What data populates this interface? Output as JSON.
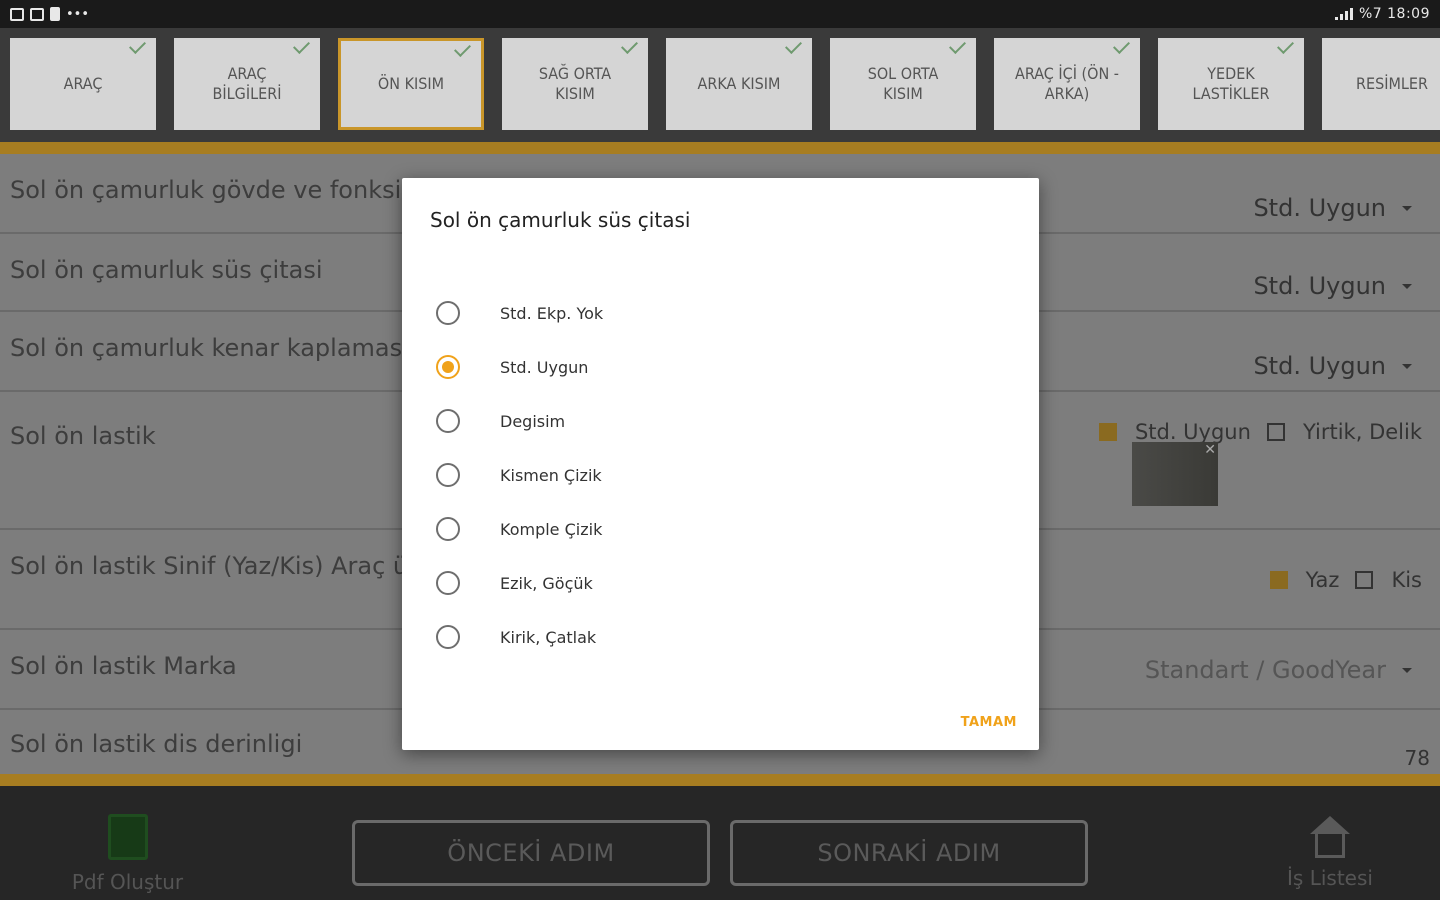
{
  "status_bar": {
    "right_text": "%7 18:09",
    "dots": "•••"
  },
  "tabs": [
    {
      "label": "ARAÇ",
      "checked": true
    },
    {
      "label": "ARAÇ\nBİLGİLERİ",
      "checked": true
    },
    {
      "label": "ÖN KISIM",
      "checked": true,
      "active": true
    },
    {
      "label": "SAĞ ORTA\nKISIM",
      "checked": true
    },
    {
      "label": "ARKA KISIM",
      "checked": true
    },
    {
      "label": "SOL ORTA\nKISIM",
      "checked": true
    },
    {
      "label": "ARAÇ İÇİ (ÖN -\nARKA)",
      "checked": true
    },
    {
      "label": "YEDEK\nLASTİKLER",
      "checked": true
    },
    {
      "label": "RESİMLER",
      "checked": false
    }
  ],
  "rows": [
    {
      "label": "Sol ön çamurluk gövde ve fonksiyo",
      "value": "Std. Uygun"
    },
    {
      "label": "Sol ön çamurluk süs çitasi",
      "value": "Std. Uygun"
    },
    {
      "label": "Sol ön çamurluk kenar kaplamasi (c",
      "value": "Std. Uygun"
    },
    {
      "label": "Sol ön lastik",
      "opt1": "Std. Uygun",
      "opt2": "Yirtik, Delik"
    },
    {
      "label": "Sol ön lastik Sinif (Yaz/Kis) Araç üze",
      "opt1": "Yaz",
      "opt2": "Kis"
    },
    {
      "label": "Sol ön lastik Marka",
      "value": "Standart / GoodYear"
    },
    {
      "label": "Sol ön lastik dis derinligi",
      "value": "78"
    }
  ],
  "bottom": {
    "pdf_label": "Pdf Oluştur",
    "prev_label": "ÖNCEKİ ADIM",
    "next_label": "SONRAKİ ADIM",
    "list_label": "İş Listesi"
  },
  "dialog": {
    "title": "Sol ön çamurluk süs çitasi",
    "options": [
      "Std. Ekp. Yok",
      "Std. Uygun",
      "Degisim",
      "Kismen Çizik",
      "Komple Çizik",
      "Ezik, Göçük",
      "Kirik, Çatlak"
    ],
    "selected_index": 1,
    "ok_label": "TAMAM"
  },
  "colors": {
    "accent": "#f0a21a",
    "gold_bar": "#a77d21"
  }
}
